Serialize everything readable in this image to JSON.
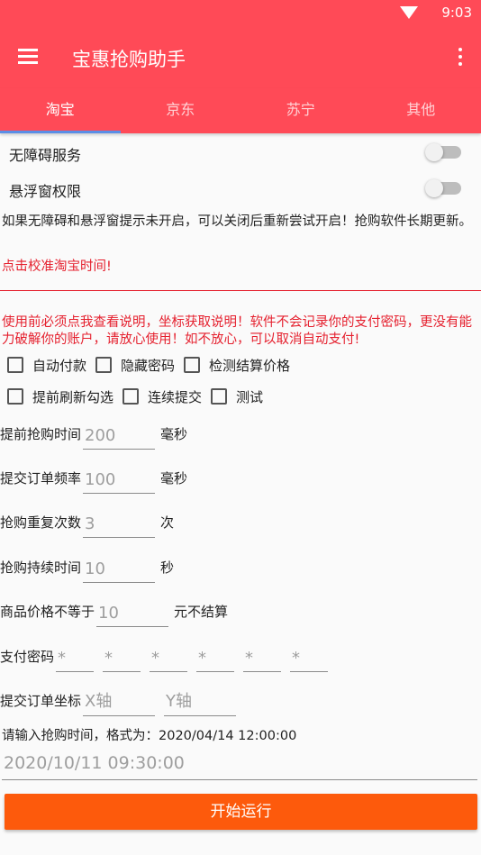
{
  "status_bar": {
    "time": "9:03",
    "wifi_icon": "wifi-icon"
  },
  "app_bar": {
    "title": "宝惠抢购助手",
    "menu_icon": "menu-icon",
    "more_icon": "more-vert-icon"
  },
  "tabs": [
    {
      "label": "淘宝",
      "active": true
    },
    {
      "label": "京东",
      "active": false
    },
    {
      "label": "苏宁",
      "active": false
    },
    {
      "label": "其他",
      "active": false
    }
  ],
  "switches": {
    "accessibility": {
      "label": "无障碍服务",
      "on": false
    },
    "overlay": {
      "label": "悬浮窗权限",
      "on": false
    }
  },
  "notice": "如果无障碍和悬浮窗提示未开启，可以关闭后重新尝试开启！抢购软件长期更新。",
  "calibrate_link": "点击校准淘宝时间!",
  "warning": "使用前必须点我查看说明，坐标获取说明！软件不会记录你的支付密码，更没有能力破解你的账户，请放心使用！如不放心，可以取消自动支付!",
  "checkboxes": {
    "auto_pay": {
      "label": "自动付款",
      "checked": false
    },
    "hide_password": {
      "label": "隐藏密码",
      "checked": false
    },
    "check_price": {
      "label": "检测结算价格",
      "checked": false
    },
    "pre_refresh": {
      "label": "提前刷新勾选",
      "checked": false
    },
    "continuous_submit": {
      "label": "连续提交",
      "checked": false
    },
    "test": {
      "label": "测试",
      "checked": false
    }
  },
  "fields": {
    "advance_time": {
      "label": "提前抢购时间",
      "placeholder": "200",
      "unit": "毫秒"
    },
    "submit_freq": {
      "label": "提交订单频率",
      "placeholder": "100",
      "unit": "毫秒"
    },
    "repeat_count": {
      "label": "抢购重复次数",
      "placeholder": "3",
      "unit": "次"
    },
    "duration": {
      "label": "抢购持续时间",
      "placeholder": "10",
      "unit": "秒"
    },
    "price_limit": {
      "label": "商品价格不等于",
      "placeholder": "10",
      "unit": "元不结算"
    }
  },
  "password": {
    "label": "支付密码",
    "digits": [
      "*",
      "*",
      "*",
      "*",
      "*",
      "*"
    ]
  },
  "coords": {
    "label": "提交订单坐标",
    "x_placeholder": "X轴",
    "y_placeholder": "Y轴"
  },
  "time_hint": "请输入抢购时间，格式为：2020/04/14 12:00:00",
  "time_input": "2020/10/11 09:30:00",
  "run_button": "开始运行"
}
